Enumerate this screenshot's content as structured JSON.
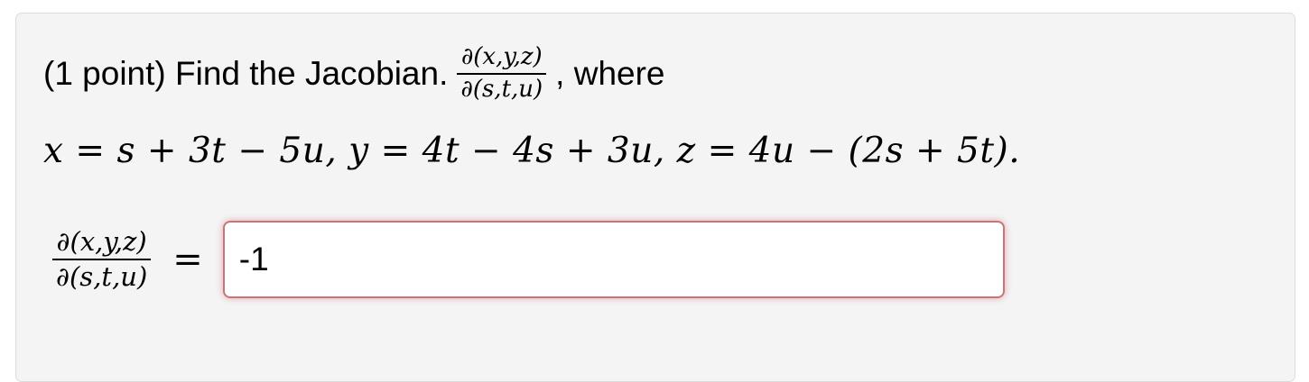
{
  "problem": {
    "prefix": "(1 point) Find the Jacobian.",
    "fraction_numerator": "∂(x,y,z)",
    "fraction_denominator": "∂(s,t,u)",
    "suffix": ", where",
    "equations": "x = s + 3t − 5u, y = 4t − 4s + 3u, z = 4u − (2s + 5t)."
  },
  "answer": {
    "fraction_numerator": "∂(x,y,z)",
    "fraction_denominator": "∂(s,t,u)",
    "equals": "=",
    "value": "-1"
  },
  "colors": {
    "card_background": "#f4f4f4",
    "input_border": "#c8747a"
  }
}
